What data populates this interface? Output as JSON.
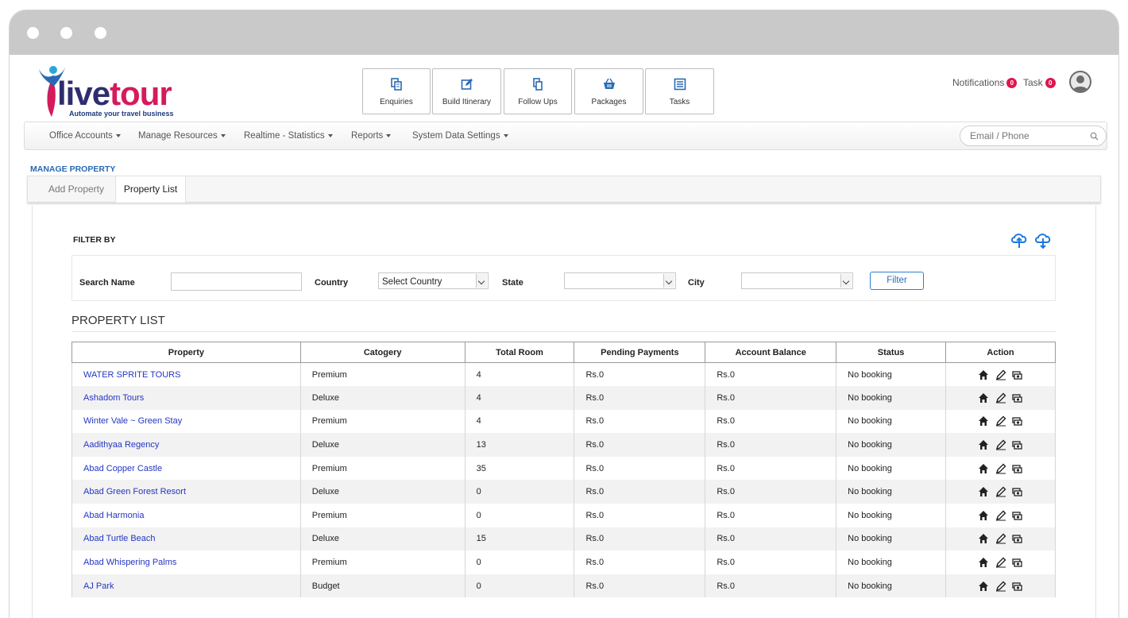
{
  "brand": {
    "name_part1": "live",
    "name_part2": "tour",
    "tagline": "Automate your travel business"
  },
  "quick_actions": [
    {
      "label": "Enquiries",
      "icon": "copy-icon"
    },
    {
      "label": "Build Itinerary",
      "icon": "edit-icon"
    },
    {
      "label": "Follow Ups",
      "icon": "files-icon"
    },
    {
      "label": "Packages",
      "icon": "basket-icon"
    },
    {
      "label": "Tasks",
      "icon": "list-icon"
    }
  ],
  "topright": {
    "notifications_label": "Notifications",
    "notifications_count": "0",
    "task_label": "Task",
    "task_count": "0"
  },
  "nav": {
    "items": [
      {
        "label": "Office Accounts"
      },
      {
        "label": "Manage Resources"
      },
      {
        "label": "Realtime - Statistics"
      },
      {
        "label": "Reports"
      },
      {
        "label": "System Data Settings"
      }
    ],
    "search_placeholder": "Email / Phone"
  },
  "page": {
    "section_title": "MANAGE PROPERTY",
    "tabs": [
      {
        "label": "Add Property"
      },
      {
        "label": "Property List"
      }
    ]
  },
  "filter": {
    "title": "FILTER BY",
    "search_name_label": "Search Name",
    "search_name_value": "",
    "country_label": "Country",
    "country_value": "Select Country",
    "state_label": "State",
    "state_value": "",
    "city_label": "City",
    "city_value": "",
    "button_label": "Filter"
  },
  "list": {
    "title": "PROPERTY LIST",
    "columns": [
      "Property",
      "Catogery",
      "Total Room",
      "Pending Payments",
      "Account Balance",
      "Status",
      "Action"
    ],
    "rows": [
      {
        "property": "WATER SPRITE TOURS",
        "category": "Premium",
        "rooms": "4",
        "pending": "Rs.0",
        "balance": "Rs.0",
        "status": "No booking"
      },
      {
        "property": "Ashadom Tours",
        "category": "Deluxe",
        "rooms": "4",
        "pending": "Rs.0",
        "balance": "Rs.0",
        "status": "No booking"
      },
      {
        "property": "Winter Vale ~ Green Stay",
        "category": "Premium",
        "rooms": "4",
        "pending": "Rs.0",
        "balance": "Rs.0",
        "status": "No booking"
      },
      {
        "property": "Aadithyaa Regency",
        "category": "Deluxe",
        "rooms": "13",
        "pending": "Rs.0",
        "balance": "Rs.0",
        "status": "No booking"
      },
      {
        "property": "Abad Copper Castle",
        "category": "Premium",
        "rooms": "35",
        "pending": "Rs.0",
        "balance": "Rs.0",
        "status": "No booking"
      },
      {
        "property": "Abad Green Forest Resort",
        "category": "Deluxe",
        "rooms": "0",
        "pending": "Rs.0",
        "balance": "Rs.0",
        "status": "No booking"
      },
      {
        "property": "Abad Harmonia",
        "category": "Premium",
        "rooms": "0",
        "pending": "Rs.0",
        "balance": "Rs.0",
        "status": "No booking"
      },
      {
        "property": "Abad Turtle Beach",
        "category": "Deluxe",
        "rooms": "15",
        "pending": "Rs.0",
        "balance": "Rs.0",
        "status": "No booking"
      },
      {
        "property": "Abad Whispering Palms",
        "category": "Premium",
        "rooms": "0",
        "pending": "Rs.0",
        "balance": "Rs.0",
        "status": "No booking"
      },
      {
        "property": "AJ Park",
        "category": "Budget",
        "rooms": "0",
        "pending": "Rs.0",
        "balance": "Rs.0",
        "status": "No booking"
      }
    ]
  },
  "colors": {
    "accent_blue": "#2a6ab3",
    "link_blue": "#2436c4",
    "brand_pink": "#d61a5c",
    "badge": "#e0164e"
  }
}
